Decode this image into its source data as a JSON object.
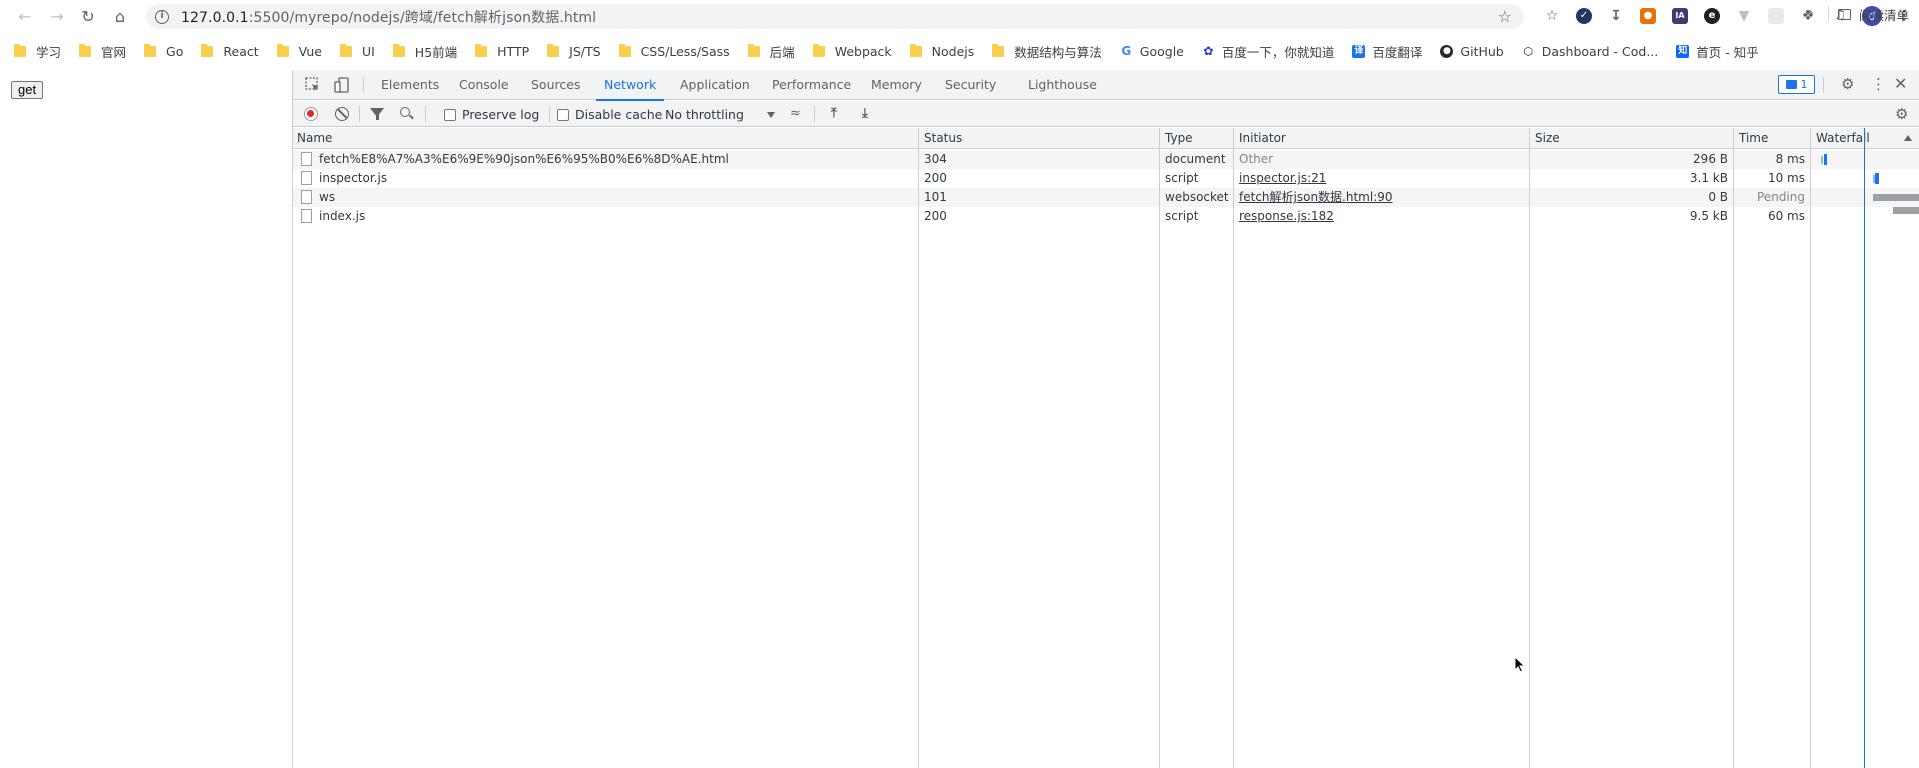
{
  "browser": {
    "url_host": "127.0.0.1",
    "url_rest": ":5500/myrepo/nodejs/跨域/fetch解析json数据.html",
    "avatar_letter": "d",
    "bookmarks": [
      {
        "label": "学习",
        "icon": "folder"
      },
      {
        "label": "官网",
        "icon": "folder"
      },
      {
        "label": "Go",
        "icon": "folder"
      },
      {
        "label": "React",
        "icon": "folder"
      },
      {
        "label": "Vue",
        "icon": "folder"
      },
      {
        "label": "UI",
        "icon": "folder"
      },
      {
        "label": "H5前端",
        "icon": "folder"
      },
      {
        "label": "HTTP",
        "icon": "folder"
      },
      {
        "label": "JS/TS",
        "icon": "folder"
      },
      {
        "label": "CSS/Less/Sass",
        "icon": "folder"
      },
      {
        "label": "后端",
        "icon": "folder"
      },
      {
        "label": "Webpack",
        "icon": "folder"
      },
      {
        "label": "Nodejs",
        "icon": "folder"
      },
      {
        "label": "数据结构与算法",
        "icon": "folder"
      },
      {
        "label": "Google",
        "icon": "google"
      },
      {
        "label": "百度一下，你就知道",
        "icon": "baidu"
      },
      {
        "label": "百度翻译",
        "icon": "baidu-translate"
      },
      {
        "label": "GitHub",
        "icon": "github"
      },
      {
        "label": "Dashboard - Cod...",
        "icon": "codepen"
      },
      {
        "label": "首页 - 知乎",
        "icon": "zhihu"
      }
    ],
    "more_bookmarks": "»",
    "reading_list": "阅读清单"
  },
  "page": {
    "button_label": "get"
  },
  "devtools": {
    "tabs": [
      "Elements",
      "Console",
      "Sources",
      "Network",
      "Application",
      "Performance",
      "Memory",
      "Security",
      "Lighthouse"
    ],
    "active_tab": "Network",
    "issues_count": "1",
    "toolbar": {
      "preserve_log": "Preserve log",
      "disable_cache": "Disable cache",
      "throttling": "No throttling"
    },
    "columns": [
      "Name",
      "Status",
      "Type",
      "Initiator",
      "Size",
      "Time",
      "Waterfall"
    ],
    "requests": [
      {
        "name": "fetch%E8%A7%A3%E6%9E%90json%E6%95%B0%E6%8D%AE.html",
        "status": "304",
        "type": "document",
        "initiator": "Other",
        "initiator_link": false,
        "size": "296 B",
        "time": "8 ms"
      },
      {
        "name": "inspector.js",
        "status": "200",
        "type": "script",
        "initiator": "inspector.js:21",
        "initiator_link": true,
        "size": "3.1 kB",
        "time": "10 ms"
      },
      {
        "name": "ws",
        "status": "101",
        "type": "websocket",
        "initiator": "fetch解析json数据.html:90",
        "initiator_link": true,
        "size": "0 B",
        "time": "Pending"
      },
      {
        "name": "index.js",
        "status": "200",
        "type": "script",
        "initiator": "response.js:182",
        "initiator_link": true,
        "size": "9.5 kB",
        "time": "60 ms"
      }
    ]
  }
}
